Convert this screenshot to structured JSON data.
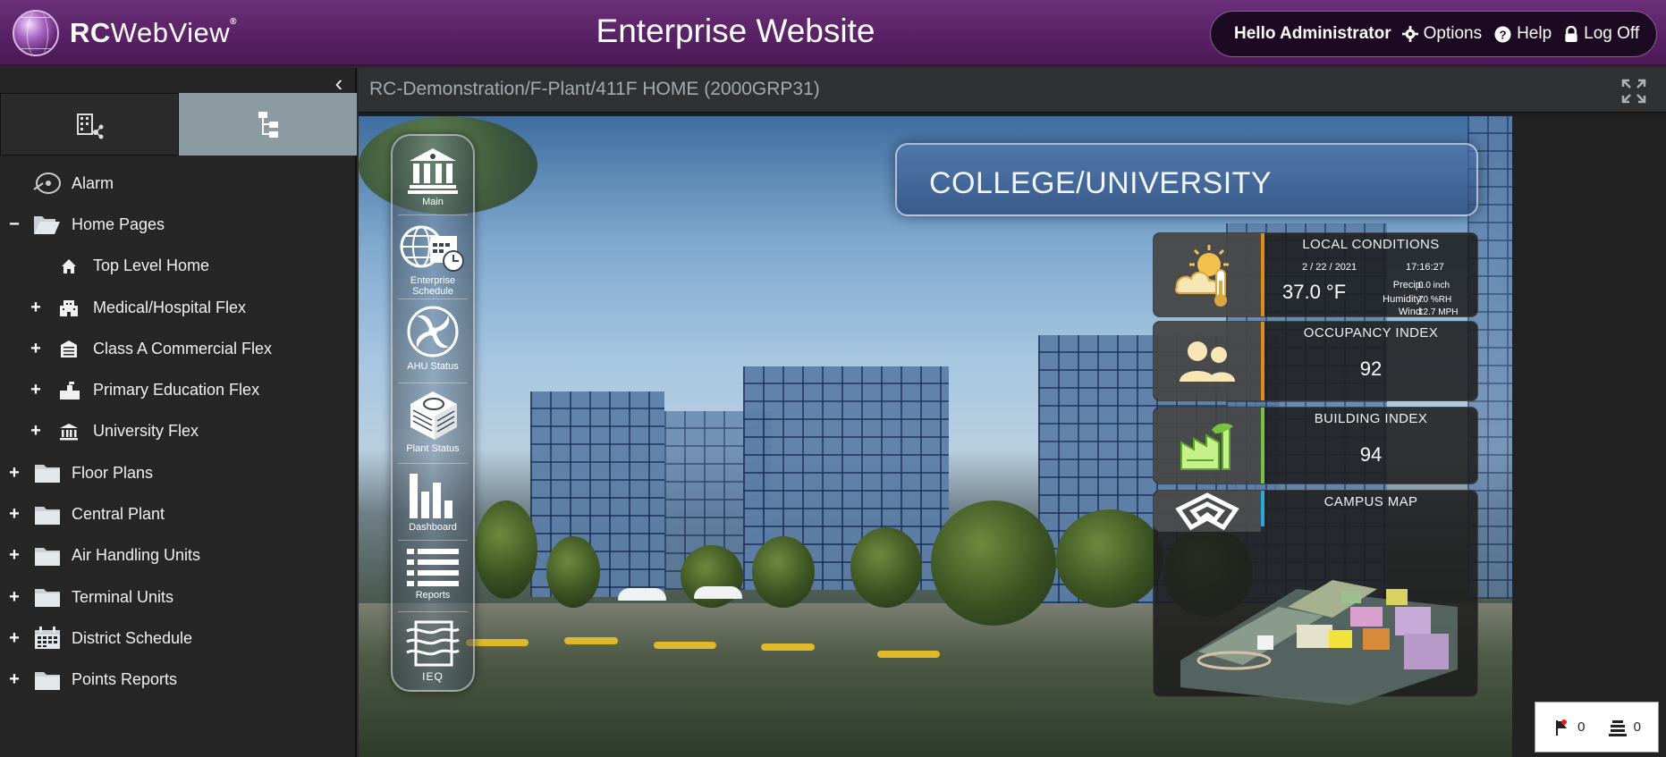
{
  "header": {
    "logo_text_rc": "RC",
    "logo_text_web": "WebView",
    "logo_reg": "®",
    "site_title": "Enterprise Website",
    "greeting": "Hello Administrator",
    "options_label": "Options",
    "help_label": "Help",
    "logoff_label": "Log Off"
  },
  "sidebar": {
    "collapse_glyph": "‹",
    "tabs": [
      {
        "name": "building-network-icon"
      },
      {
        "name": "tree-hierarchy-icon"
      }
    ],
    "tree": [
      {
        "label": "Alarm",
        "icon": "alarm-disc-icon",
        "expander": "",
        "level": 0
      },
      {
        "label": "Home Pages",
        "icon": "open-folder-icon",
        "expander": "−",
        "level": 0
      },
      {
        "label": "Top Level Home",
        "icon": "home-icon",
        "expander": "",
        "level": 1
      },
      {
        "label": "Medical/Hospital Flex",
        "icon": "hospital-icon",
        "expander": "+",
        "level": 1
      },
      {
        "label": "Class A Commercial Flex",
        "icon": "commercial-building-icon",
        "expander": "+",
        "level": 1
      },
      {
        "label": "Primary Education Flex",
        "icon": "school-icon",
        "expander": "+",
        "level": 1
      },
      {
        "label": "University Flex",
        "icon": "university-icon",
        "expander": "+",
        "level": 1
      },
      {
        "label": "Floor Plans",
        "icon": "folder-icon",
        "expander": "+",
        "level": 0
      },
      {
        "label": "Central Plant",
        "icon": "folder-icon",
        "expander": "+",
        "level": 0
      },
      {
        "label": "Air Handling Units",
        "icon": "folder-icon",
        "expander": "+",
        "level": 0
      },
      {
        "label": "Terminal Units",
        "icon": "folder-icon",
        "expander": "+",
        "level": 0
      },
      {
        "label": "District Schedule",
        "icon": "calendar-icon",
        "expander": "+",
        "level": 0
      },
      {
        "label": "Points Reports",
        "icon": "folder-icon",
        "expander": "+",
        "level": 0
      }
    ]
  },
  "main": {
    "path": "RC-Demonstration/F-Plant/411F HOME (2000GRP31)",
    "banner_title": "COLLEGE/UNIVERSITY",
    "menu": [
      {
        "label": "Main"
      },
      {
        "label": "Enterprise Schedule"
      },
      {
        "label": "AHU Status"
      },
      {
        "label": "Plant Status"
      },
      {
        "label": "Dashboard"
      },
      {
        "label": "Reports"
      },
      {
        "label": "IEQ"
      }
    ],
    "local_conditions": {
      "title": "LOCAL CONDITIONS",
      "date": "2 / 22 /  2021",
      "time": "17:16:27",
      "temperature": "37.0 °F",
      "precip_label": "Precip:",
      "precip_value": "0.0 inch",
      "humidity_label": "Humidity:",
      "humidity_value": "70 %RH",
      "wind_label": "Wind:",
      "wind_value": "12.7 MPH",
      "accent_color": "#e08a1a"
    },
    "occupancy": {
      "title": "OCCUPANCY INDEX",
      "value": "92",
      "accent_color": "#e08a1a"
    },
    "building": {
      "title": "BUILDING INDEX",
      "value": "94",
      "accent_color": "#7ac142"
    },
    "campus": {
      "title": "CAMPUS MAP",
      "accent_color": "#29a8e0"
    }
  },
  "counters": {
    "alarms": "0",
    "reports": "0"
  },
  "colors": {
    "header_purple": "#5a2266",
    "sidebar_bg": "#262626",
    "tab_active": "#8c9aa1"
  }
}
